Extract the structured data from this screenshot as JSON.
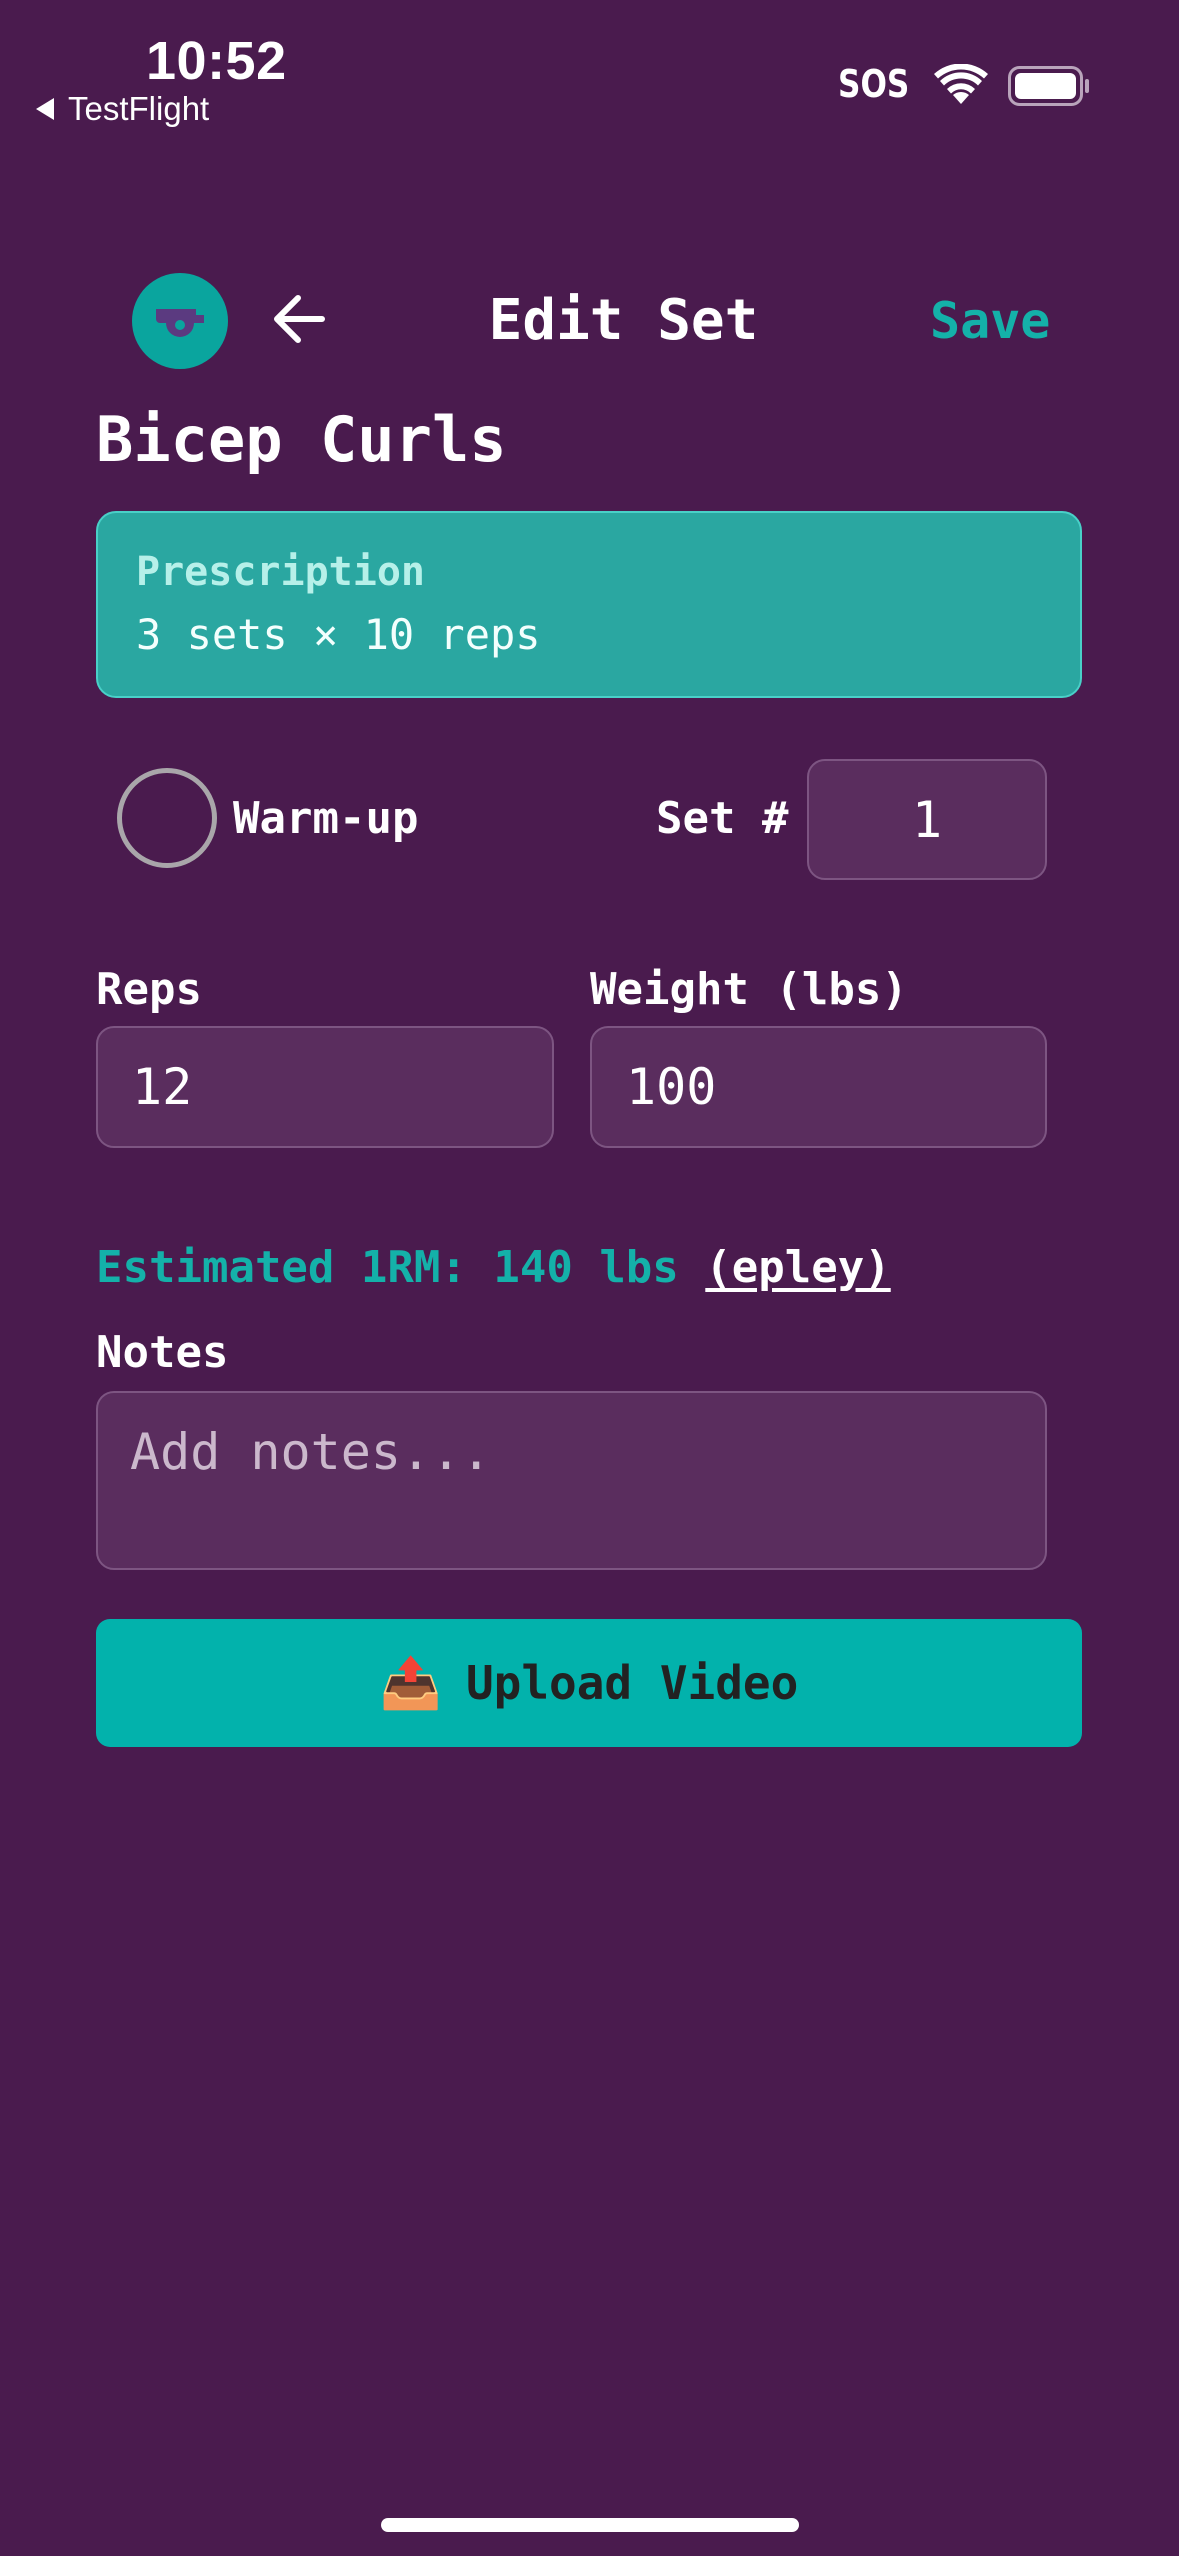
{
  "status_bar": {
    "time": "10:52",
    "back_app": "TestFlight",
    "carrier": "SOS"
  },
  "header": {
    "logo_icon": "whistle-icon",
    "title": "Edit Set",
    "save_label": "Save"
  },
  "exercise": {
    "name": "Bicep Curls"
  },
  "prescription": {
    "label": "Prescription",
    "value": "3 sets × 10 reps"
  },
  "warmup": {
    "label": "Warm-up",
    "checked": false
  },
  "set_number": {
    "label": "Set #",
    "value": "1"
  },
  "reps": {
    "label": "Reps",
    "value": "12"
  },
  "weight": {
    "label": "Weight (lbs)",
    "value": "100"
  },
  "estimate": {
    "text": "Estimated 1RM: 140 lbs",
    "formula": "(epley)"
  },
  "notes": {
    "label": "Notes",
    "placeholder": "Add notes..."
  },
  "upload": {
    "icon": "📤",
    "label": "Upload Video"
  },
  "colors": {
    "background": "#4a1b4e",
    "accent": "#14b1a9",
    "card": "#2aa7a1",
    "button": "#02b2ac"
  }
}
